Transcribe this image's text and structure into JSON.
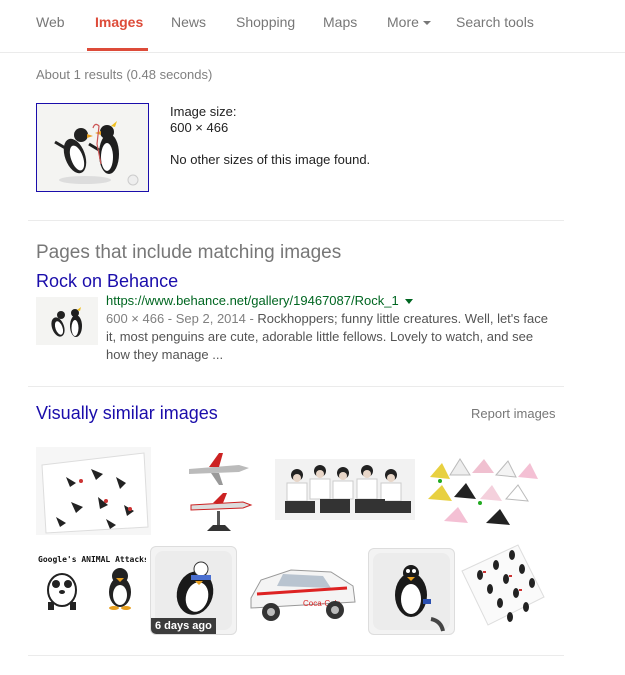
{
  "tabs": [
    {
      "label": "Web"
    },
    {
      "label": "Images"
    },
    {
      "label": "News"
    },
    {
      "label": "Shopping"
    },
    {
      "label": "Maps"
    },
    {
      "label": "More"
    },
    {
      "label": "Search tools"
    }
  ],
  "active_tab": "Images",
  "colors": {
    "accent": "#dd4b39",
    "link": "#1a0dab",
    "url": "#006621"
  },
  "stats": "About 1 results (0.48 seconds)",
  "image_info": {
    "size_label": "Image size:",
    "size_value": "600 × 466",
    "no_other_sizes": "No other sizes of this image found."
  },
  "pages_section": {
    "title": "Pages that include matching images",
    "result": {
      "title": "Rock on Behance",
      "url": "https://www.behance.net/gallery/19467087/Rock_1",
      "meta": "600 × 466 - Sep 2, 2014 - ",
      "snippet": "Rockhoppers; funny little creatures. Well, let's face it, most penguins are cute, adorable little fellows. Lovely to watch, and see how they manage ..."
    }
  },
  "similar_section": {
    "title": "Visually similar images",
    "report": "Report images",
    "tile_caption": "Google's ANIMAL Attacks",
    "badge": "6 days ago",
    "images": [
      {
        "icon": "penguin-sketches-image"
      },
      {
        "icon": "jet-models-image"
      },
      {
        "icon": "group-photo-image"
      },
      {
        "icon": "cat-ear-headbands-image"
      },
      {
        "icon": "animal-attacks-image"
      },
      {
        "icon": "penguin-tile-image"
      },
      {
        "icon": "rally-car-image"
      },
      {
        "icon": "penguin-tile-2-image"
      },
      {
        "icon": "penguin-wrapping-paper-image"
      }
    ]
  }
}
